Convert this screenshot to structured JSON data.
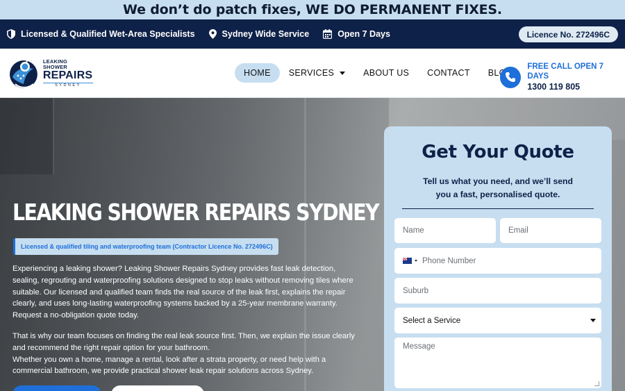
{
  "promo": {
    "text": "We don’t do patch fixes, WE DO PERMANENT FIXES."
  },
  "infobar": {
    "items": [
      {
        "icon": "shield-icon",
        "label": "Licensed & Qualified Wet-Area Specialists"
      },
      {
        "icon": "location-pin-icon",
        "label": "Sydney Wide Service"
      },
      {
        "icon": "calendar-icon",
        "label": "Open 7 Days"
      }
    ],
    "licence": "Licence No. 272496C"
  },
  "header": {
    "logo": {
      "line1": "LEAKING SHOWER",
      "line2": "REPAIRS",
      "line3": "SYDNEY"
    },
    "nav": [
      {
        "label": "HOME",
        "active": true
      },
      {
        "label": "SERVICES",
        "dropdown": true
      },
      {
        "label": "ABOUT US"
      },
      {
        "label": "CONTACT"
      },
      {
        "label": "BLOG"
      }
    ],
    "call": {
      "icon": "phone-icon",
      "label": "FREE CALL OPEN 7 DAYS",
      "number": "1300 119 805"
    }
  },
  "hero": {
    "title": "LEAKING SHOWER REPAIRS SYDNEY",
    "tag": "Licensed & qualified tiling and waterproofing team (Contractor Licence No. 272496C)",
    "paragraph1": "Experiencing a leaking shower? Leaking Shower Repairs Sydney provides fast leak detection, sealing, regrouting and waterproofing solutions designed to stop leaks without removing tiles where suitable. Our licensed and qualified team finds the real source of the leak first, explains the repair clearly, and uses long-lasting waterproofing systems backed by a 25-year membrane warranty. Request a no-obligation quote today.",
    "paragraph2": "That is why our team focuses on finding the real leak source first. Then, we explain the issue clearly and recommend the right repair option for your bathroom.",
    "paragraph3": "Whether you own a home, manage a rental, look after a strata property, or need help with a commercial bathroom, we provide practical shower leak repair solutions across Sydney."
  },
  "quote": {
    "title": "Get Your Quote",
    "subtitle": "Tell us what you need, and we’ll send you a fast, personalised quote.",
    "fields": {
      "name_placeholder": "Name",
      "email_placeholder": "Email",
      "phone_placeholder": "Phone Number",
      "suburb_placeholder": "Suburb",
      "service_value": "Select a Service",
      "message_placeholder": "Message"
    }
  },
  "colors": {
    "navy": "#0e2148",
    "accent_blue": "#1e6fd9",
    "light_blue": "#c7def0"
  }
}
